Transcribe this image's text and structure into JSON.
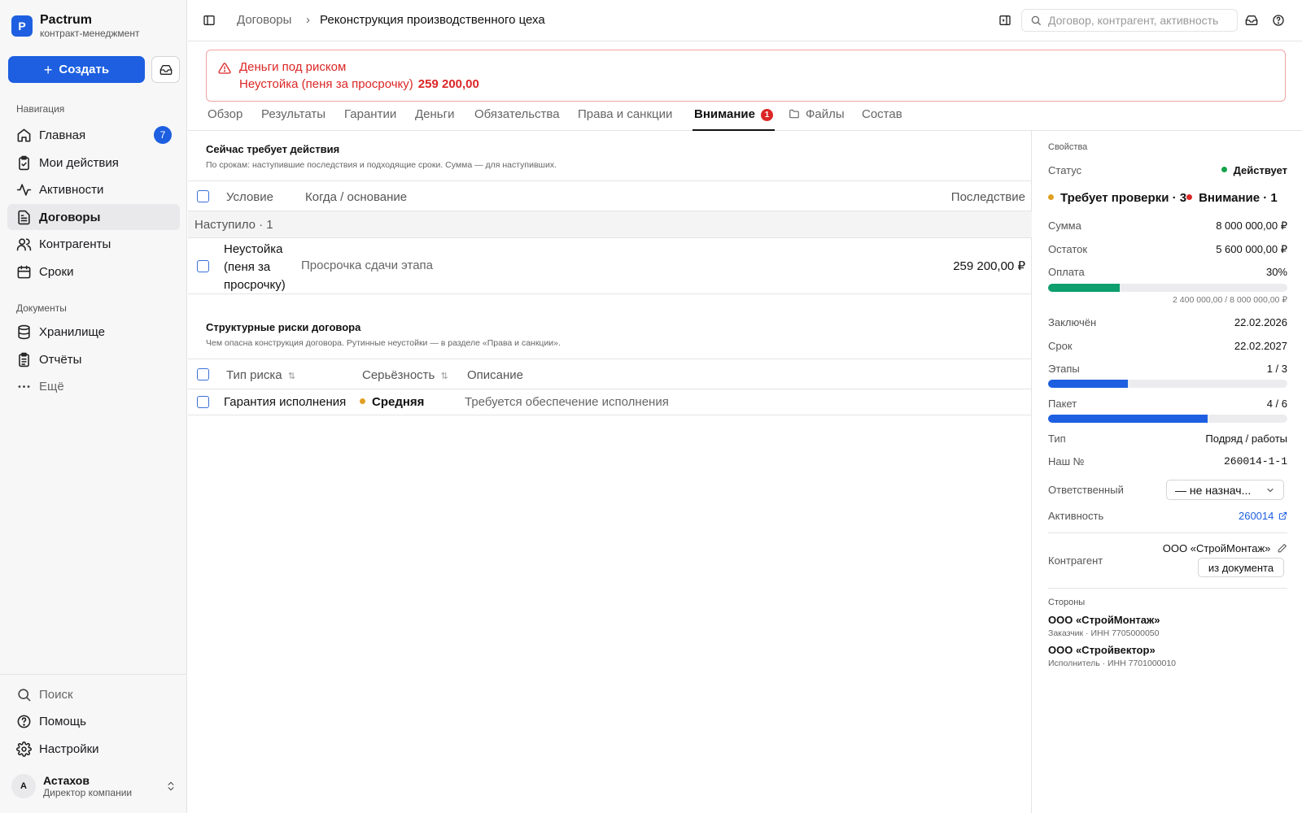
{
  "brand": {
    "name": "Pactrum",
    "subtitle": "контракт-менеджмент",
    "logo": "P"
  },
  "sidebar": {
    "create_label": "Создать",
    "nav_section": "Навигация",
    "nav_items": [
      {
        "label": "Главная",
        "icon": "home-icon",
        "badge": "7"
      },
      {
        "label": "Мои действия",
        "icon": "clipboard-check-icon"
      },
      {
        "label": "Активности",
        "icon": "activity-icon"
      },
      {
        "label": "Договоры",
        "icon": "document-icon",
        "active": true
      },
      {
        "label": "Контрагенты",
        "icon": "users-icon"
      },
      {
        "label": "Сроки",
        "icon": "calendar-icon"
      }
    ],
    "docs_section": "Документы",
    "doc_items": [
      {
        "label": "Хранилище",
        "icon": "database-icon"
      },
      {
        "label": "Отчёты",
        "icon": "clipboard-list-icon"
      },
      {
        "label": "Ещё",
        "icon": "more-icon"
      }
    ],
    "bottom_items": [
      {
        "label": "Поиск",
        "icon": "search-icon"
      },
      {
        "label": "Помощь",
        "icon": "help-icon"
      },
      {
        "label": "Настройки",
        "icon": "gear-icon"
      }
    ],
    "user": {
      "initial": "А",
      "name": "Астахов",
      "role": "Директор компании"
    }
  },
  "topbar": {
    "breadcrumb_parent": "Договоры",
    "breadcrumb_sep": "›",
    "breadcrumb_current": "Реконструкция производственного цеха",
    "search_placeholder": "Договор, контрагент, активность"
  },
  "alert": {
    "title": "Деньги под риском",
    "text": "Неустойка (пеня за просрочку)",
    "amount": "259 200,00"
  },
  "tabs": [
    {
      "label": "Обзор"
    },
    {
      "label": "Результаты"
    },
    {
      "label": "Гарантии"
    },
    {
      "label": "Деньги"
    },
    {
      "label": "Обязательства"
    },
    {
      "label": "Права и санкции"
    },
    {
      "label": "Внимание",
      "badge": "1",
      "active": true
    },
    {
      "label": "Файлы",
      "icon": "folder-icon"
    },
    {
      "label": "Состав"
    }
  ],
  "action_section": {
    "title": "Сейчас требует действия",
    "description": "По срокам: наступившие последствия и подходящие сроки. Сумма — для наступивших.",
    "columns": [
      "Условие",
      "Когда / основание",
      "Последствие"
    ],
    "group_label": "Наступило · 1",
    "rows": [
      {
        "condition_lines": [
          "Неустойка",
          "(пеня за",
          "просрочку)"
        ],
        "basis": "Просрочка сдачи этапа",
        "consequence": "259 200,00 ₽"
      }
    ]
  },
  "risks_section": {
    "title": "Структурные риски договора",
    "description": "Чем опасна конструкция договора. Рутинные неустойки — в разделе «Права и санкции».",
    "columns": [
      "Тип риска",
      "Серьёзность",
      "Описание"
    ],
    "rows": [
      {
        "type": "Гарантия исполнения",
        "severity": "Средняя",
        "severity_color": "#e0a020",
        "description": "Требуется обеспечение исполнения"
      }
    ]
  },
  "properties": {
    "section_label": "Свойства",
    "status_label": "Статус",
    "status_value": "Действует",
    "status_color": "#16a34a",
    "flags": [
      {
        "label": "Требует проверки · 3",
        "color": "#e0a020"
      },
      {
        "label": "Внимание · 1",
        "color": "#dc2626"
      }
    ],
    "sum_label": "Сумма",
    "sum_value": "8 000 000,00 ₽",
    "remain_label": "Остаток",
    "remain_value": "5 600 000,00 ₽",
    "payment_label": "Оплата",
    "payment_value": "30%",
    "payment_fraction": 0.3,
    "payment_detail": "2 400 000,00 / 8 000 000,00 ₽",
    "concluded_label": "Заключён",
    "concluded_value": "22.02.2026",
    "term_label": "Срок",
    "term_value": "22.02.2027",
    "stages_label": "Этапы",
    "stages_value": "1 / 3",
    "stages_fraction": 0.333,
    "package_label": "Пакет",
    "package_value": "4 / 6",
    "package_fraction": 0.667,
    "type_label": "Тип",
    "type_value": "Подряд / работы",
    "our_no_label": "Наш №",
    "our_no_value": "260014-1-1",
    "responsible_label": "Ответственный",
    "responsible_value": "— не назнач...",
    "activity_label": "Активность",
    "activity_value": "260014",
    "counterparty_label": "Контрагент",
    "counterparty_value": "ООО «СтройМонтаж»",
    "from_doc_label": "из документа",
    "parties_label": "Стороны",
    "parties": [
      {
        "name": "ООО «СтройМонтаж»",
        "role": "Заказчик · ИНН 7705000050"
      },
      {
        "name": "ООО «Стройвектор»",
        "role": "Исполнитель · ИНН 7701000010"
      }
    ]
  },
  "colors": {
    "accent": "#1d5fe0",
    "danger": "#dc2626",
    "success": "#16a34a",
    "progress_green": "#0e9f6e"
  }
}
